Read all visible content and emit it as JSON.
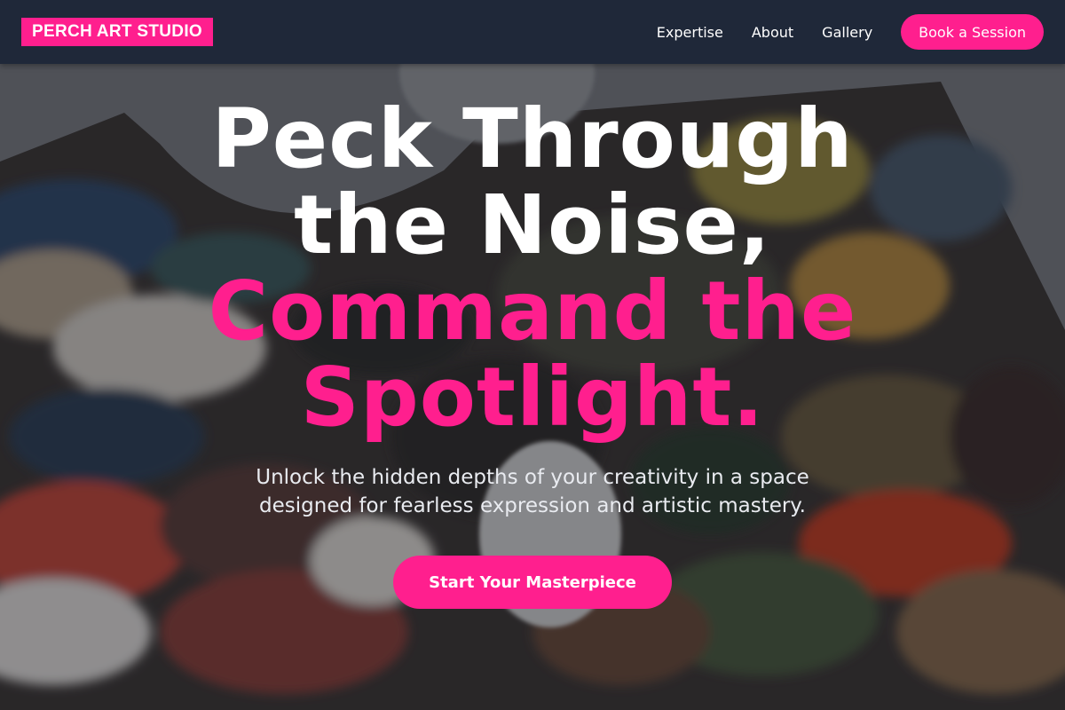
{
  "brand": {
    "name": "PERCH ART STUDIO",
    "accent": "#ff1f8e",
    "nav_bg": "#1f2839"
  },
  "nav": {
    "links": [
      "Expertise",
      "About",
      "Gallery"
    ],
    "cta_label": "Book a Session"
  },
  "hero": {
    "headline_line1": "Peck Through",
    "headline_line2": "the Noise,",
    "headline_line3": "Command the",
    "headline_line4": "Spotlight.",
    "subtitle": "Unlock the hidden depths of your creativity in a space designed for fearless expression and artistic mastery.",
    "cta_label": "Start Your Masterpiece"
  }
}
